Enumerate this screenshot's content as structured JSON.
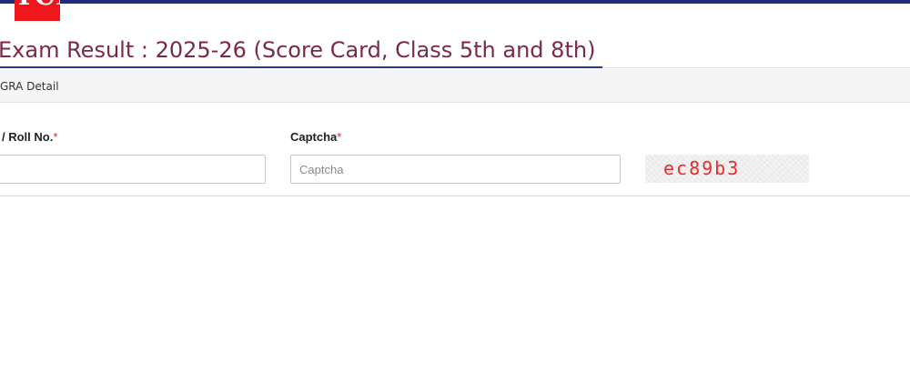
{
  "header": {
    "logo_text": "TCF",
    "top_bar_color": "#1f2a7a",
    "logo_color": "#f0161b"
  },
  "page": {
    "title": "Exam Result : 2025-26 (Score Card, Class 5th and 8th)",
    "title_color": "#7a2a47"
  },
  "panel": {
    "header_text": "GRA Detail"
  },
  "form": {
    "roll_label": "/ Roll No.",
    "roll_required_mark": "*",
    "roll_value": "",
    "roll_placeholder": "",
    "captcha_label": "Captcha",
    "captcha_required_mark": "*",
    "captcha_value": "",
    "captcha_placeholder": "Captcha",
    "captcha_code": "ec89b3"
  }
}
